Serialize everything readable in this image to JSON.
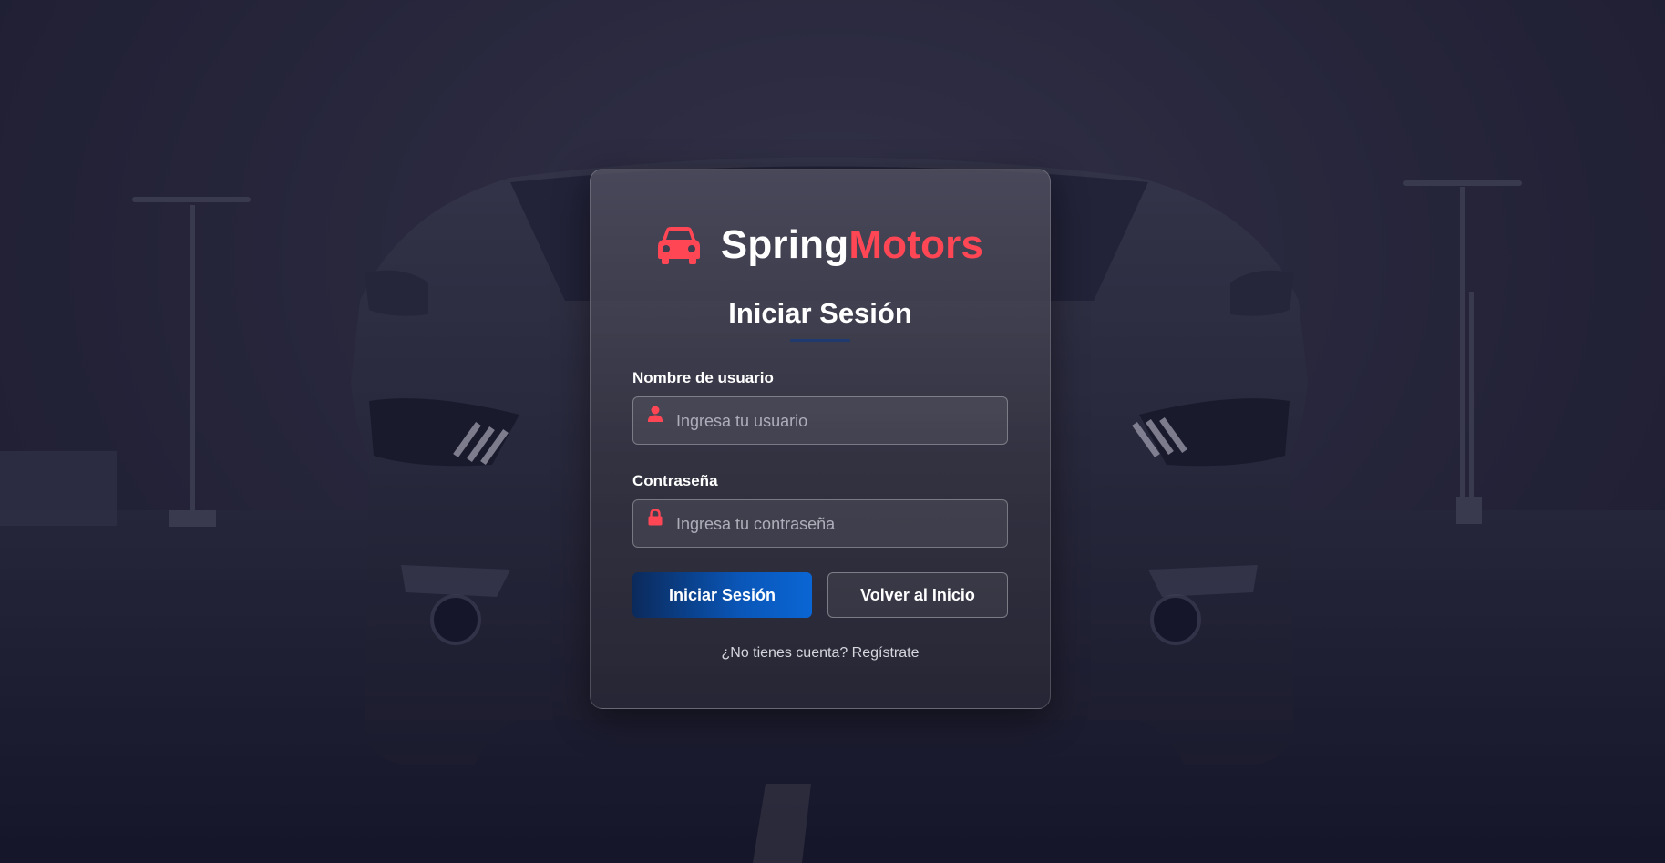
{
  "brand": {
    "name_part1": "Spring",
    "name_part2": "Motors",
    "icon": "car-icon",
    "accent_color": "#ff4655"
  },
  "login": {
    "title": "Iniciar Sesión",
    "username": {
      "label": "Nombre de usuario",
      "placeholder": "Ingresa tu usuario",
      "value": "",
      "icon": "user-icon"
    },
    "password": {
      "label": "Contraseña",
      "placeholder": "Ingresa tu contraseña",
      "value": "",
      "icon": "lock-icon"
    },
    "submit_label": "Iniciar Sesión",
    "back_label": "Volver al Inicio",
    "register_link": "¿No tienes cuenta? Regístrate"
  },
  "colors": {
    "primary_button": "#0a56b8",
    "title_underline": "#1e3a6e",
    "background": "#2b2a40"
  }
}
